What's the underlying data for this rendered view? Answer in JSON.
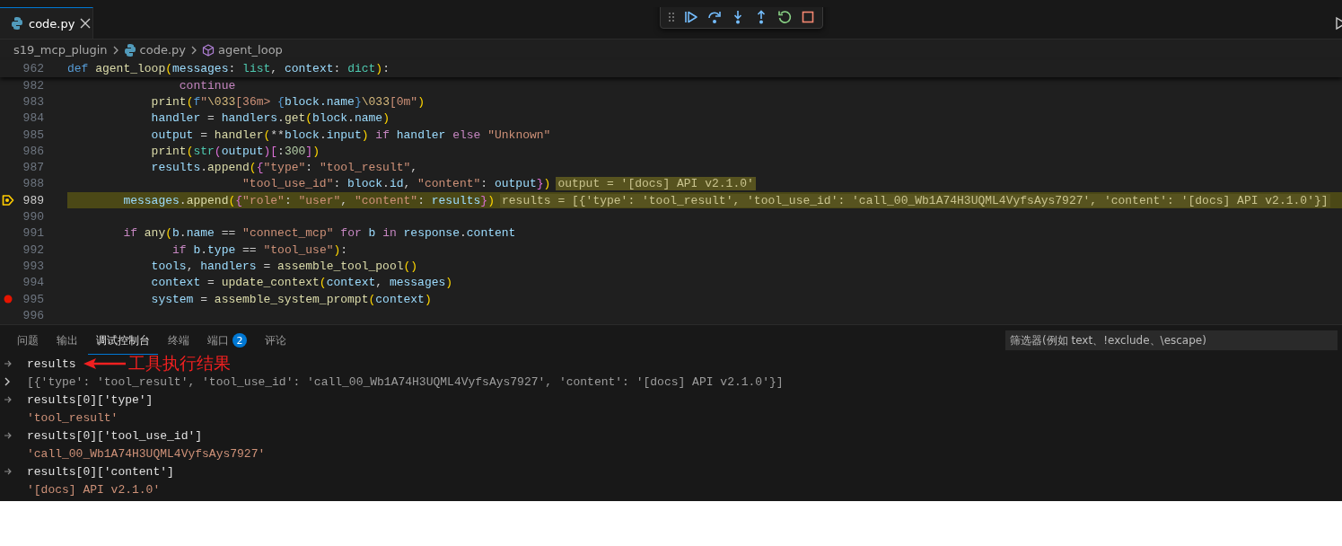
{
  "editor_tabs": [
    {
      "label": "code.py",
      "selected": true
    }
  ],
  "breadcrumb": [
    {
      "label": "s19_mcp_plugin",
      "kind": "folder"
    },
    {
      "label": "code.py",
      "kind": "file"
    },
    {
      "label": "agent_loop",
      "kind": "symbol"
    }
  ],
  "sticky_line": {
    "number": "962",
    "tokens": [
      {
        "text": "def",
        "kind": "keyword"
      },
      {
        "text": " agent_loop",
        "kind": "function"
      },
      {
        "text": "(",
        "kind": "bracket1"
      },
      {
        "text": "messages",
        "kind": "variable"
      },
      {
        "text": ": ",
        "kind": "plain"
      },
      {
        "text": "list",
        "kind": "type"
      },
      {
        "text": ", ",
        "kind": "plain"
      },
      {
        "text": "context",
        "kind": "variable"
      },
      {
        "text": ": ",
        "kind": "plain"
      },
      {
        "text": "dict",
        "kind": "type"
      },
      {
        "text": ")",
        "kind": "bracket1"
      },
      {
        "text": ":",
        "kind": "plain"
      }
    ]
  },
  "code": {
    "lines": [
      {
        "number": "982",
        "paused": false,
        "breakpoint": false,
        "tokens": [
          {
            "text": "                continue",
            "kind": "control"
          }
        ]
      },
      {
        "number": "983",
        "paused": false,
        "breakpoint": false,
        "tokens": [
          {
            "text": "            print",
            "kind": "function"
          },
          {
            "text": "(",
            "kind": "bracket1"
          },
          {
            "text": "f",
            "kind": "keyword"
          },
          {
            "text": "\"",
            "kind": "string"
          },
          {
            "text": "\\033",
            "kind": "escape"
          },
          {
            "text": "[36m> ",
            "kind": "string"
          },
          {
            "text": "{",
            "kind": "keyword"
          },
          {
            "text": "block.name",
            "kind": "variable"
          },
          {
            "text": "}",
            "kind": "keyword"
          },
          {
            "text": "\\033",
            "kind": "escape"
          },
          {
            "text": "[0m\"",
            "kind": "string"
          },
          {
            "text": ")",
            "kind": "bracket1"
          }
        ]
      },
      {
        "number": "984",
        "paused": false,
        "breakpoint": false,
        "tokens": [
          {
            "text": "            handler",
            "kind": "variable"
          },
          {
            "text": " = ",
            "kind": "plain"
          },
          {
            "text": "handlers",
            "kind": "variable"
          },
          {
            "text": ".",
            "kind": "plain"
          },
          {
            "text": "get",
            "kind": "function"
          },
          {
            "text": "(",
            "kind": "bracket1"
          },
          {
            "text": "block",
            "kind": "variable"
          },
          {
            "text": ".",
            "kind": "plain"
          },
          {
            "text": "name",
            "kind": "variable"
          },
          {
            "text": ")",
            "kind": "bracket1"
          }
        ]
      },
      {
        "number": "985",
        "paused": false,
        "breakpoint": false,
        "tokens": [
          {
            "text": "            output",
            "kind": "variable"
          },
          {
            "text": " = ",
            "kind": "plain"
          },
          {
            "text": "handler",
            "kind": "function"
          },
          {
            "text": "(",
            "kind": "bracket1"
          },
          {
            "text": "**",
            "kind": "plain"
          },
          {
            "text": "block",
            "kind": "variable"
          },
          {
            "text": ".",
            "kind": "plain"
          },
          {
            "text": "input",
            "kind": "variable"
          },
          {
            "text": ")",
            "kind": "bracket1"
          },
          {
            "text": " if",
            "kind": "control"
          },
          {
            "text": " handler",
            "kind": "variable"
          },
          {
            "text": " else",
            "kind": "control"
          },
          {
            "text": " \"Unknown\"",
            "kind": "string"
          }
        ]
      },
      {
        "number": "986",
        "paused": false,
        "breakpoint": false,
        "tokens": [
          {
            "text": "            print",
            "kind": "function"
          },
          {
            "text": "(",
            "kind": "bracket1"
          },
          {
            "text": "str",
            "kind": "type"
          },
          {
            "text": "(",
            "kind": "bracket2"
          },
          {
            "text": "output",
            "kind": "variable"
          },
          {
            "text": ")",
            "kind": "bracket2"
          },
          {
            "text": "[",
            "kind": "bracket2"
          },
          {
            "text": ":",
            "kind": "plain"
          },
          {
            "text": "300",
            "kind": "number"
          },
          {
            "text": "]",
            "kind": "bracket2"
          },
          {
            "text": ")",
            "kind": "bracket1"
          }
        ]
      },
      {
        "number": "987",
        "paused": false,
        "breakpoint": false,
        "tokens": [
          {
            "text": "            results",
            "kind": "variable"
          },
          {
            "text": ".",
            "kind": "plain"
          },
          {
            "text": "append",
            "kind": "function"
          },
          {
            "text": "(",
            "kind": "bracket1"
          },
          {
            "text": "{",
            "kind": "bracket2"
          },
          {
            "text": "\"type\"",
            "kind": "string"
          },
          {
            "text": ": ",
            "kind": "plain"
          },
          {
            "text": "\"tool_result\"",
            "kind": "string"
          },
          {
            "text": ",",
            "kind": "plain"
          }
        ]
      },
      {
        "number": "988",
        "paused": false,
        "breakpoint": false,
        "tokens": [
          {
            "text": "                         \"tool_use_id\"",
            "kind": "string"
          },
          {
            "text": ": ",
            "kind": "plain"
          },
          {
            "text": "block",
            "kind": "variable"
          },
          {
            "text": ".",
            "kind": "plain"
          },
          {
            "text": "id",
            "kind": "variable"
          },
          {
            "text": ", ",
            "kind": "plain"
          },
          {
            "text": "\"content\"",
            "kind": "string"
          },
          {
            "text": ": ",
            "kind": "plain"
          },
          {
            "text": "output",
            "kind": "variable"
          },
          {
            "text": "}",
            "kind": "bracket2"
          },
          {
            "text": ")",
            "kind": "bracket1"
          }
        ],
        "inline_value": "output = '[docs] API v2.1.0'"
      },
      {
        "number": "989",
        "paused": true,
        "breakpoint": true,
        "tokens": [
          {
            "text": "        messages",
            "kind": "variable"
          },
          {
            "text": ".",
            "kind": "plain"
          },
          {
            "text": "append",
            "kind": "function"
          },
          {
            "text": "(",
            "kind": "bracket1"
          },
          {
            "text": "{",
            "kind": "bracket2"
          },
          {
            "text": "\"role\"",
            "kind": "string"
          },
          {
            "text": ": ",
            "kind": "plain"
          },
          {
            "text": "\"user\"",
            "kind": "string"
          },
          {
            "text": ", ",
            "kind": "plain"
          },
          {
            "text": "\"content\"",
            "kind": "string"
          },
          {
            "text": ": ",
            "kind": "plain"
          },
          {
            "text": "results",
            "kind": "variable"
          },
          {
            "text": "}",
            "kind": "bracket2"
          },
          {
            "text": ")",
            "kind": "bracket1"
          }
        ],
        "inline_value": "results = [{'type': 'tool_result', 'tool_use_id': 'call_00_Wb1A74H3UQML4VyfsAys7927', 'content': '[docs] API v2.1.0'}]"
      },
      {
        "number": "990",
        "paused": false,
        "breakpoint": false
      },
      {
        "number": "991",
        "paused": false,
        "breakpoint": false,
        "tokens": [
          {
            "text": "        if",
            "kind": "control"
          },
          {
            "text": " any",
            "kind": "function"
          },
          {
            "text": "(",
            "kind": "bracket1"
          },
          {
            "text": "b",
            "kind": "variable"
          },
          {
            "text": ".",
            "kind": "plain"
          },
          {
            "text": "name",
            "kind": "variable"
          },
          {
            "text": " == ",
            "kind": "plain"
          },
          {
            "text": "\"connect_mcp\"",
            "kind": "string"
          },
          {
            "text": " for",
            "kind": "control"
          },
          {
            "text": " b",
            "kind": "variable"
          },
          {
            "text": " in",
            "kind": "control"
          },
          {
            "text": " response",
            "kind": "variable"
          },
          {
            "text": ".",
            "kind": "plain"
          },
          {
            "text": "content",
            "kind": "variable"
          }
        ]
      },
      {
        "number": "992",
        "paused": false,
        "breakpoint": false,
        "tokens": [
          {
            "text": "               if",
            "kind": "control"
          },
          {
            "text": " b",
            "kind": "variable"
          },
          {
            "text": ".",
            "kind": "plain"
          },
          {
            "text": "type",
            "kind": "variable"
          },
          {
            "text": " == ",
            "kind": "plain"
          },
          {
            "text": "\"tool_use\"",
            "kind": "string"
          },
          {
            "text": ")",
            "kind": "bracket1"
          },
          {
            "text": ":",
            "kind": "plain"
          }
        ]
      },
      {
        "number": "993",
        "paused": false,
        "breakpoint": false,
        "tokens": [
          {
            "text": "            tools",
            "kind": "variable"
          },
          {
            "text": ", ",
            "kind": "plain"
          },
          {
            "text": "handlers",
            "kind": "variable"
          },
          {
            "text": " = ",
            "kind": "plain"
          },
          {
            "text": "assemble_tool_pool",
            "kind": "function"
          },
          {
            "text": "()",
            "kind": "bracket1"
          }
        ]
      },
      {
        "number": "994",
        "paused": false,
        "breakpoint": false,
        "tokens": [
          {
            "text": "            context",
            "kind": "variable"
          },
          {
            "text": " = ",
            "kind": "plain"
          },
          {
            "text": "update_context",
            "kind": "function"
          },
          {
            "text": "(",
            "kind": "bracket1"
          },
          {
            "text": "context",
            "kind": "variable"
          },
          {
            "text": ", ",
            "kind": "plain"
          },
          {
            "text": "messages",
            "kind": "variable"
          },
          {
            "text": ")",
            "kind": "bracket1"
          }
        ]
      },
      {
        "number": "995",
        "paused": false,
        "breakpoint": true,
        "tokens": [
          {
            "text": "            system",
            "kind": "variable"
          },
          {
            "text": " = ",
            "kind": "plain"
          },
          {
            "text": "assemble_system_prompt",
            "kind": "function"
          },
          {
            "text": "(",
            "kind": "bracket1"
          },
          {
            "text": "context",
            "kind": "variable"
          },
          {
            "text": ")",
            "kind": "bracket1"
          }
        ]
      },
      {
        "number": "996",
        "paused": false,
        "breakpoint": false
      }
    ]
  },
  "panel": {
    "tabs": [
      {
        "label": "问题",
        "selected": false
      },
      {
        "label": "输出",
        "selected": false
      },
      {
        "label": "调试控制台",
        "selected": true
      },
      {
        "label": "终端",
        "selected": false
      },
      {
        "label": "端口",
        "badge": "2",
        "selected": false
      },
      {
        "label": "评论",
        "selected": false
      }
    ],
    "filter": {
      "placeholder": "筛选器(例如 text、!exclude、\\escape)"
    },
    "console": [
      {
        "kind": "input",
        "text": "results"
      },
      {
        "kind": "output",
        "text": "[{'type': 'tool_result', 'tool_use_id': 'call_00_Wb1A74H3UQML4VyfsAys7927', 'content': '[docs] API v2.1.0'}]"
      },
      {
        "kind": "input",
        "text": "results[0]['type']"
      },
      {
        "kind": "string",
        "text": "'tool_result'"
      },
      {
        "kind": "input",
        "text": "results[0]['tool_use_id']"
      },
      {
        "kind": "string",
        "text": "'call_00_Wb1A74H3UQML4VyfsAys7927'"
      },
      {
        "kind": "input",
        "text": "results[0]['content']"
      },
      {
        "kind": "string",
        "text": "'[docs] API v2.1.0'"
      }
    ],
    "annotation": {
      "text": "工具执行结果"
    }
  }
}
